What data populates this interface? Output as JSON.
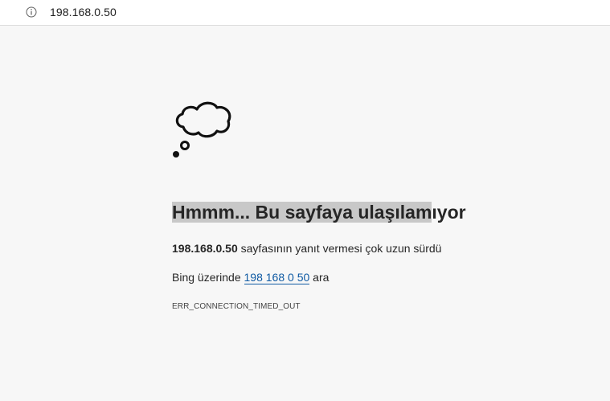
{
  "address_bar": {
    "url": "198.168.0.50",
    "icon": "info-icon"
  },
  "error_page": {
    "icon": "thought-cloud-icon",
    "heading_highlighted": "Hmmm... Bu sayfaya ulaşılam",
    "heading_rest": "ıyor",
    "host": "198.168.0.50",
    "message_suffix": " sayfasının yanıt vermesi çok uzun sürdü",
    "search_prefix": "Bing üzerinde ",
    "search_link": "198 168 0 50",
    "search_suffix": " ara",
    "error_code": "ERR_CONNECTION_TIMED_OUT"
  }
}
